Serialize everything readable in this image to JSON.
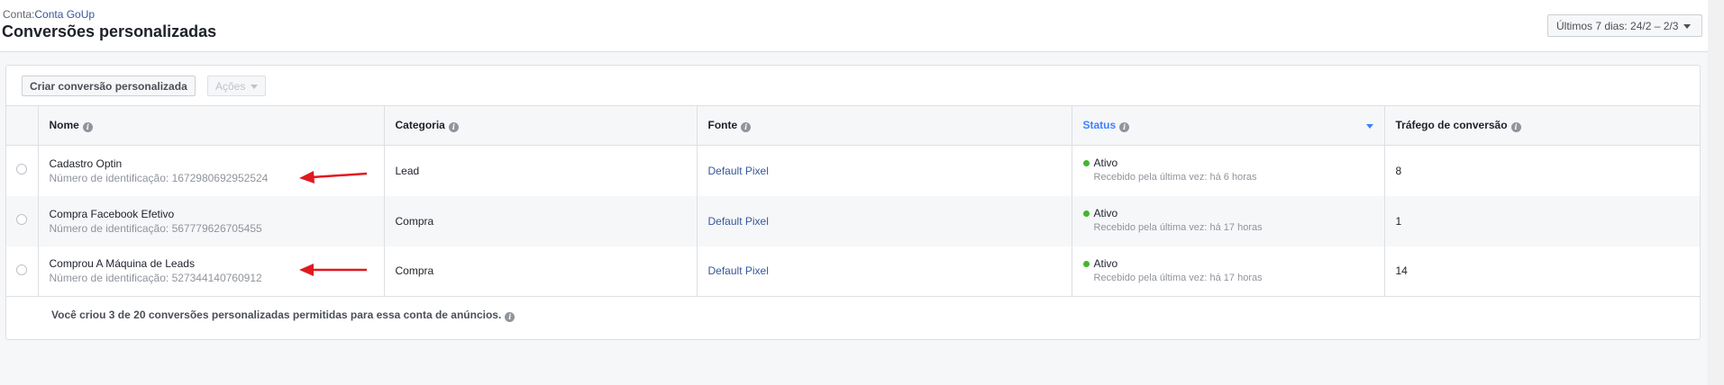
{
  "header": {
    "account_prefix": "Conta:",
    "account_name": "Conta GoUp",
    "title": "Conversões personalizadas",
    "date_range": "Últimos 7 dias: 24/2 – 2/3"
  },
  "toolbar": {
    "create_label": "Criar conversão personalizada",
    "actions_label": "Ações"
  },
  "table": {
    "columns": {
      "name": "Nome",
      "category": "Categoria",
      "source": "Fonte",
      "status": "Status",
      "traffic": "Tráfego de conversão"
    },
    "rows": [
      {
        "name": "Cadastro Optin",
        "id_label": "Número de identificação: 1672980692952524",
        "category": "Lead",
        "source": "Default Pixel",
        "status": "Ativo",
        "status_detail": "Recebido pela última vez: há 6 horas",
        "traffic": "8"
      },
      {
        "name": "Compra Facebook Efetivo",
        "id_label": "Número de identificação: 567779626705455",
        "category": "Compra",
        "source": "Default Pixel",
        "status": "Ativo",
        "status_detail": "Recebido pela última vez: há 17 horas",
        "traffic": "1"
      },
      {
        "name": "Comprou A Máquina de Leads",
        "id_label": "Número de identificação: 527344140760912",
        "category": "Compra",
        "source": "Default Pixel",
        "status": "Ativo",
        "status_detail": "Recebido pela última vez: há 17 horas",
        "traffic": "14"
      }
    ]
  },
  "footer": {
    "note": "Você criou 3 de 20 conversões personalizadas permitidas para essa conta de anúncios."
  },
  "colors": {
    "link": "#365899",
    "status_active": "#42b72a",
    "sort_accent": "#4080ff",
    "annotation_arrow": "#e0191f"
  },
  "icons": {
    "info": "info-icon",
    "status": "green-dot-icon",
    "annotation": "red-arrow-icon"
  }
}
